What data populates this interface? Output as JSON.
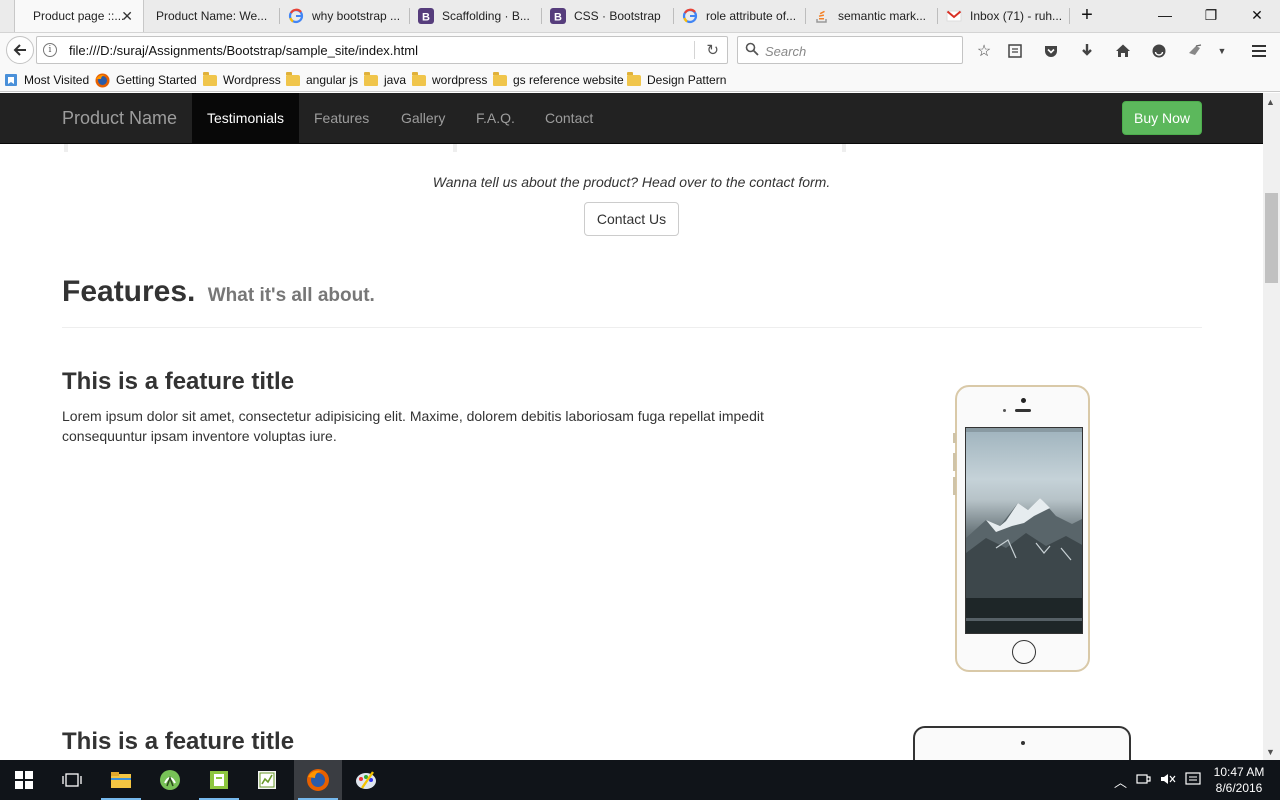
{
  "browser": {
    "tabs": [
      {
        "label": "Product page ::...",
        "icon": "page-icon",
        "active": true
      },
      {
        "label": "Product Name: We...",
        "icon": "page-icon"
      },
      {
        "label": "why bootstrap ...",
        "icon": "google-icon"
      },
      {
        "label": "Scaffolding · B...",
        "icon": "bootstrap-icon"
      },
      {
        "label": "CSS · Bootstrap",
        "icon": "bootstrap-icon"
      },
      {
        "label": "role attribute of...",
        "icon": "google-icon"
      },
      {
        "label": "semantic mark...",
        "icon": "stackoverflow-icon"
      },
      {
        "label": "Inbox (71) - ruh...",
        "icon": "gmail-icon"
      }
    ],
    "url": "file:///D:/suraj/Assignments/Bootstrap/sample_site/index.html",
    "search_placeholder": "Search",
    "bookmarks": [
      {
        "label": "Most Visited",
        "icon": "bookmark-icon"
      },
      {
        "label": "Getting Started",
        "icon": "firefox-icon"
      },
      {
        "label": "Wordpress",
        "icon": "folder-icon"
      },
      {
        "label": "angular js",
        "icon": "folder-icon"
      },
      {
        "label": "java",
        "icon": "folder-icon"
      },
      {
        "label": "wordpress",
        "icon": "folder-icon"
      },
      {
        "label": "gs reference website",
        "icon": "folder-icon"
      },
      {
        "label": "Design Pattern",
        "icon": "folder-icon"
      }
    ]
  },
  "site": {
    "brand": "Product Name",
    "nav": [
      {
        "label": "Testimonials",
        "active": true
      },
      {
        "label": "Features"
      },
      {
        "label": "Gallery"
      },
      {
        "label": "F.A.Q."
      },
      {
        "label": "Contact"
      }
    ],
    "buy_now": "Buy Now",
    "cta_text": "Wanna tell us about the product? Head over to the contact form.",
    "contact_button": "Contact Us",
    "features_heading": "Features.",
    "features_subheading": "What it's all about.",
    "features": [
      {
        "title": "This is a feature title",
        "text": "Lorem ipsum dolor sit amet, consectetur adipisicing elit. Maxime, dolorem debitis laboriosam fuga repellat impedit consequuntur ipsam inventore voluptas iure."
      },
      {
        "title": "This is a feature title",
        "text": ""
      }
    ]
  },
  "taskbar": {
    "apps": [
      "windows-start-icon",
      "task-view-icon",
      "file-explorer-icon",
      "android-studio-icon",
      "notepad-plus-icon",
      "sublime-icon",
      "firefox-icon",
      "paint-icon"
    ],
    "time": "10:47 AM",
    "date": "8/6/2016"
  },
  "colors": {
    "navbar_bg": "#222222",
    "buy_now": "#5cb85c",
    "tab_active": "#f9f9f9",
    "taskbar_bg": "#101419"
  }
}
